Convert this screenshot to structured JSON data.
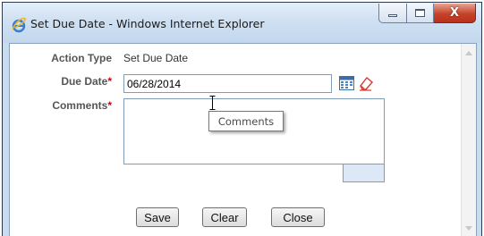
{
  "window": {
    "title": "Set Due Date - Windows Internet Explorer",
    "controls": {
      "minimize_icon": "minimize-icon",
      "maximize_icon": "maximize-icon",
      "close_glyph": "X"
    },
    "colors": {
      "titlebar": "#c9dcee",
      "close_button": "#c5432a"
    }
  },
  "form": {
    "action_type": {
      "label": "Action Type",
      "value": "Set Due Date"
    },
    "due_date": {
      "label": "Due Date",
      "required_marker": "*",
      "value": "06/28/2014",
      "calendar_icon": "calendar-icon",
      "clear_icon": "eraser-icon"
    },
    "comments": {
      "label": "Comments",
      "required_marker": "*",
      "value": "",
      "tooltip": "Comments"
    },
    "buttons": {
      "save": "Save",
      "clear": "Clear",
      "close": "Close"
    }
  },
  "colors": {
    "required": "#cc0000",
    "label": "#555555"
  }
}
